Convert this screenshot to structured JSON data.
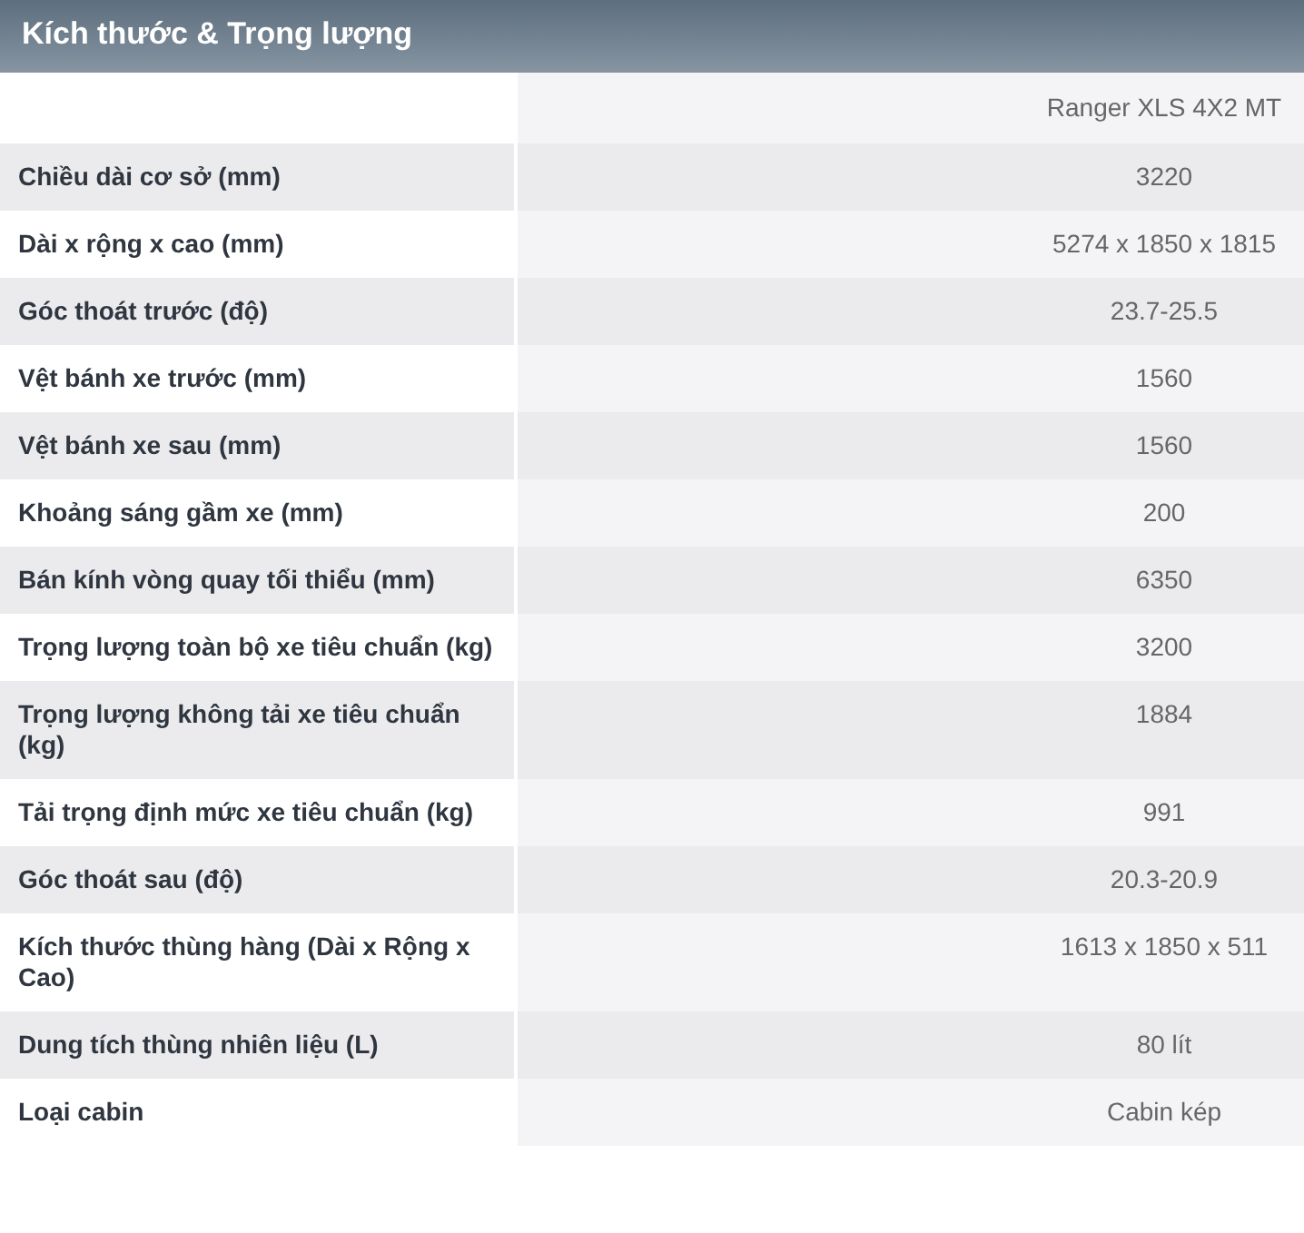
{
  "section": {
    "title": "Kích thước & Trọng lượng"
  },
  "table": {
    "columns": [
      "Ranger XLS 4X2 MT"
    ],
    "rows": [
      {
        "label": "Chiều dài cơ sở (mm)",
        "value": "3220"
      },
      {
        "label": "Dài x rộng x cao (mm)",
        "value": "5274 x 1850 x 1815"
      },
      {
        "label": "Góc thoát trước (độ)",
        "value": "23.7-25.5"
      },
      {
        "label": "Vệt bánh xe trước (mm)",
        "value": "1560"
      },
      {
        "label": "Vệt bánh xe sau (mm)",
        "value": "1560"
      },
      {
        "label": "Khoảng sáng gầm xe (mm)",
        "value": "200"
      },
      {
        "label": "Bán kính vòng quay tối thiểu (mm)",
        "value": "6350"
      },
      {
        "label": "Trọng lượng toàn bộ xe tiêu chuẩn (kg)",
        "value": "3200"
      },
      {
        "label": "Trọng lượng không tải xe tiêu chuẩn (kg)",
        "value": "1884"
      },
      {
        "label": "Tải trọng định mức xe tiêu chuẩn (kg)",
        "value": "991"
      },
      {
        "label": "Góc thoát sau (độ)",
        "value": "20.3-20.9"
      },
      {
        "label": "Kích thước thùng hàng (Dài x Rộng x Cao)",
        "value": "1613 x 1850 x 511"
      },
      {
        "label": "Dung tích thùng nhiên liệu (L)",
        "value": "80 lít"
      },
      {
        "label": "Loại cabin",
        "value": "Cabin kép"
      }
    ]
  }
}
